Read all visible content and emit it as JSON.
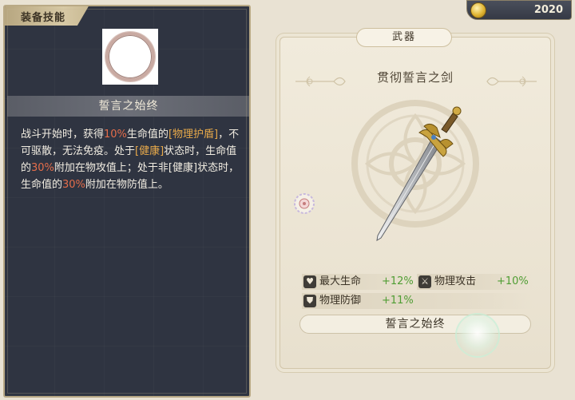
{
  "skill_panel": {
    "tab_label": "装备技能",
    "skill_name": "誓言之始终",
    "description": [
      {
        "text": "战斗开始时，获得",
        "style": "normal"
      },
      {
        "text": "10%",
        "style": "red"
      },
      {
        "text": "生命值的",
        "style": "normal"
      },
      {
        "text": "[物理护盾]",
        "style": "orange"
      },
      {
        "text": "，不可驱散，无法免疫。处于",
        "style": "normal"
      },
      {
        "text": "[健康]",
        "style": "orange"
      },
      {
        "text": "状态时，生命值的",
        "style": "normal"
      },
      {
        "text": "30%",
        "style": "red"
      },
      {
        "text": "附加在物攻值上；处于非[健康]状态时，生命值的",
        "style": "normal"
      },
      {
        "text": "30%",
        "style": "red"
      },
      {
        "text": "附加在物防值上。",
        "style": "normal"
      }
    ],
    "icon": "ring-icon"
  },
  "currency": {
    "icon": "gold-coin-icon",
    "value": "2020"
  },
  "weapon": {
    "category_tab": "武器",
    "name": "贯彻誓言之剑",
    "image": "sword-icon",
    "stats": [
      {
        "icon": "heart-icon",
        "label": "最大生命",
        "value": "+12%"
      },
      {
        "icon": "sword-icon",
        "label": "物理攻击",
        "value": "+10%"
      },
      {
        "icon": "shield-icon",
        "label": "物理防御",
        "value": "+11%"
      }
    ],
    "skill_link_label": "誓言之始终"
  },
  "colors": {
    "panel_dark": "#2f3441",
    "highlight_orange": "#e7a94a",
    "highlight_red": "#e56d4a",
    "stat_green": "#4f9d33",
    "card_bg": "#f1ebdc"
  }
}
